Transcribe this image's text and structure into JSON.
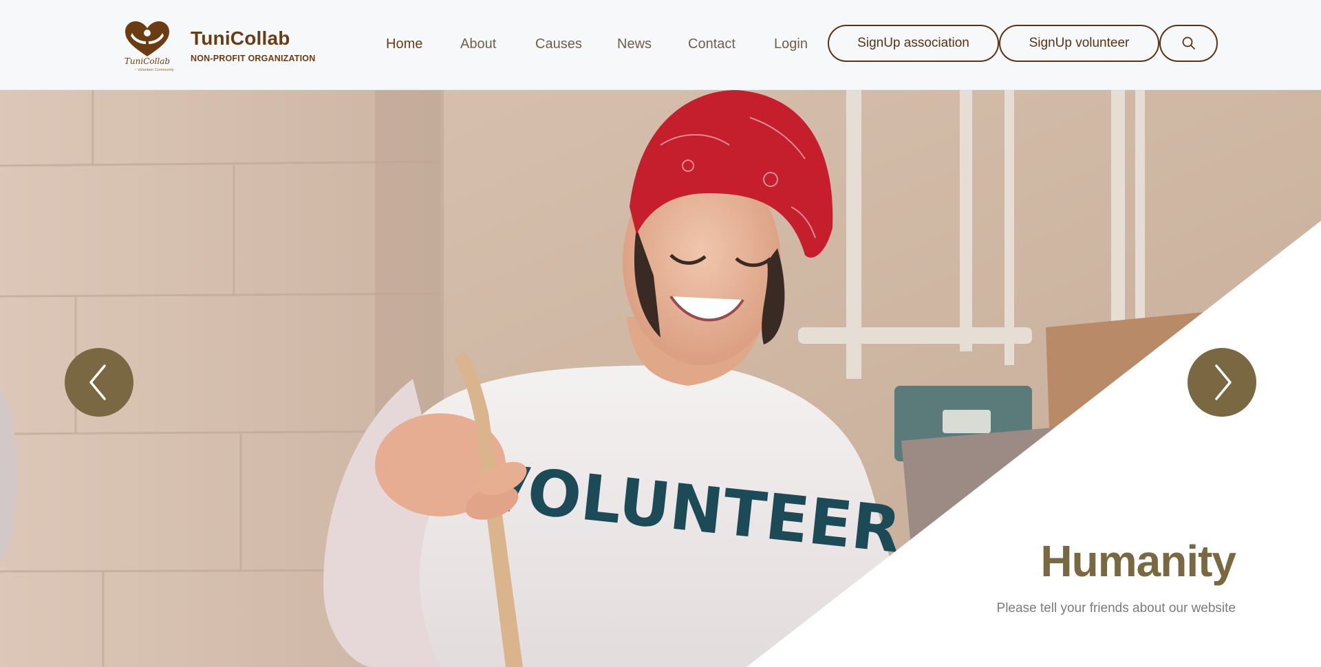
{
  "brand": {
    "name": "TuniCollab",
    "subtitle": "NON-PROFIT ORGANIZATION",
    "logo_text": "TuniCollab",
    "logo_tagline": "~ Volunteer Community",
    "color": "#6b3c14"
  },
  "nav": {
    "items": [
      {
        "label": "Home",
        "active": true
      },
      {
        "label": "About",
        "active": false
      },
      {
        "label": "Causes",
        "active": false
      },
      {
        "label": "News",
        "active": false
      },
      {
        "label": "Contact",
        "active": false
      },
      {
        "label": "Login",
        "active": false
      }
    ],
    "signup_association": "SignUp association",
    "signup_volunteer": "SignUp volunteer",
    "search_icon": "search-icon"
  },
  "hero": {
    "image": "volunteer woman in red bandana wearing VOLUNTEER t-shirt",
    "shirt_text": "VOLUNTEER",
    "title": "Humanity",
    "subtitle": "Please tell your friends about our website",
    "prev_icon": "chevron-left-icon",
    "next_icon": "chevron-right-icon",
    "accent_color": "#7a6843"
  }
}
